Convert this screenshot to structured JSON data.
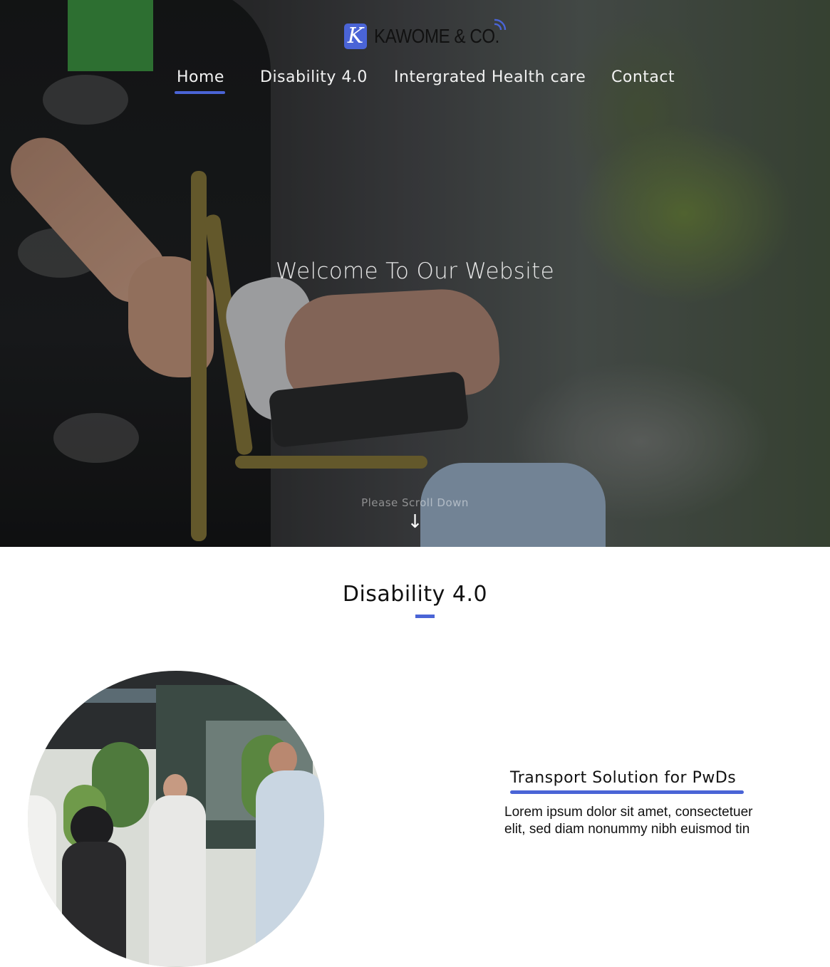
{
  "brand": {
    "logo_letter": "K",
    "name": "KAWOME & CO."
  },
  "nav": {
    "items": [
      {
        "label": "Home",
        "active": true
      },
      {
        "label": "Disability 4.0",
        "active": false
      },
      {
        "label": "Intergrated Health care",
        "active": false
      },
      {
        "label": "Contact",
        "active": false
      }
    ]
  },
  "hero": {
    "title": "Welcome To Our Website",
    "scroll_label": "Please Scroll Down",
    "scroll_arrow": "↓"
  },
  "section": {
    "title": "Disability 4.0"
  },
  "feature": {
    "title": "Transport Solution for PwDs",
    "text": "Lorem ipsum dolor sit amet, consectetuer elit, sed diam nonummy nibh euismod tin"
  },
  "colors": {
    "accent": "#4a64d6",
    "text_dark": "#111111",
    "nav_text": "#f2f2f2"
  },
  "icons": {
    "logo": "k-logo-icon",
    "signal": "signal-waves-icon",
    "arrow": "arrow-down-icon"
  }
}
